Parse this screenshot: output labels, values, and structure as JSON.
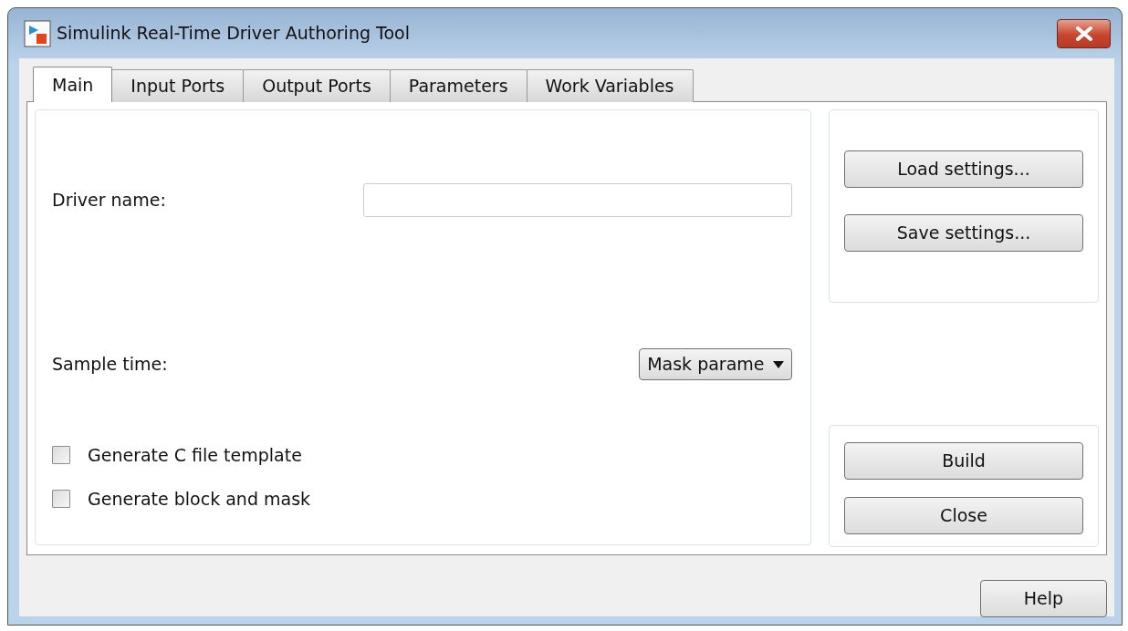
{
  "window": {
    "title": "Simulink Real-Time Driver Authoring Tool"
  },
  "tabs": [
    {
      "label": "Main",
      "selected": true
    },
    {
      "label": "Input Ports",
      "selected": false
    },
    {
      "label": "Output Ports",
      "selected": false
    },
    {
      "label": "Parameters",
      "selected": false
    },
    {
      "label": "Work Variables",
      "selected": false
    }
  ],
  "driver_name": {
    "label": "Driver name:"
  },
  "sample_time": {
    "label": "Sample time:",
    "value": "Mask parame"
  },
  "checkboxes": [
    {
      "label": "Generate C file template",
      "checked": false
    },
    {
      "label": "Generate block and mask",
      "checked": false
    }
  ],
  "settings_buttons": [
    "Load settings...",
    "Save settings..."
  ],
  "action_buttons": [
    "Build",
    "Close"
  ],
  "help_button": "Help"
}
